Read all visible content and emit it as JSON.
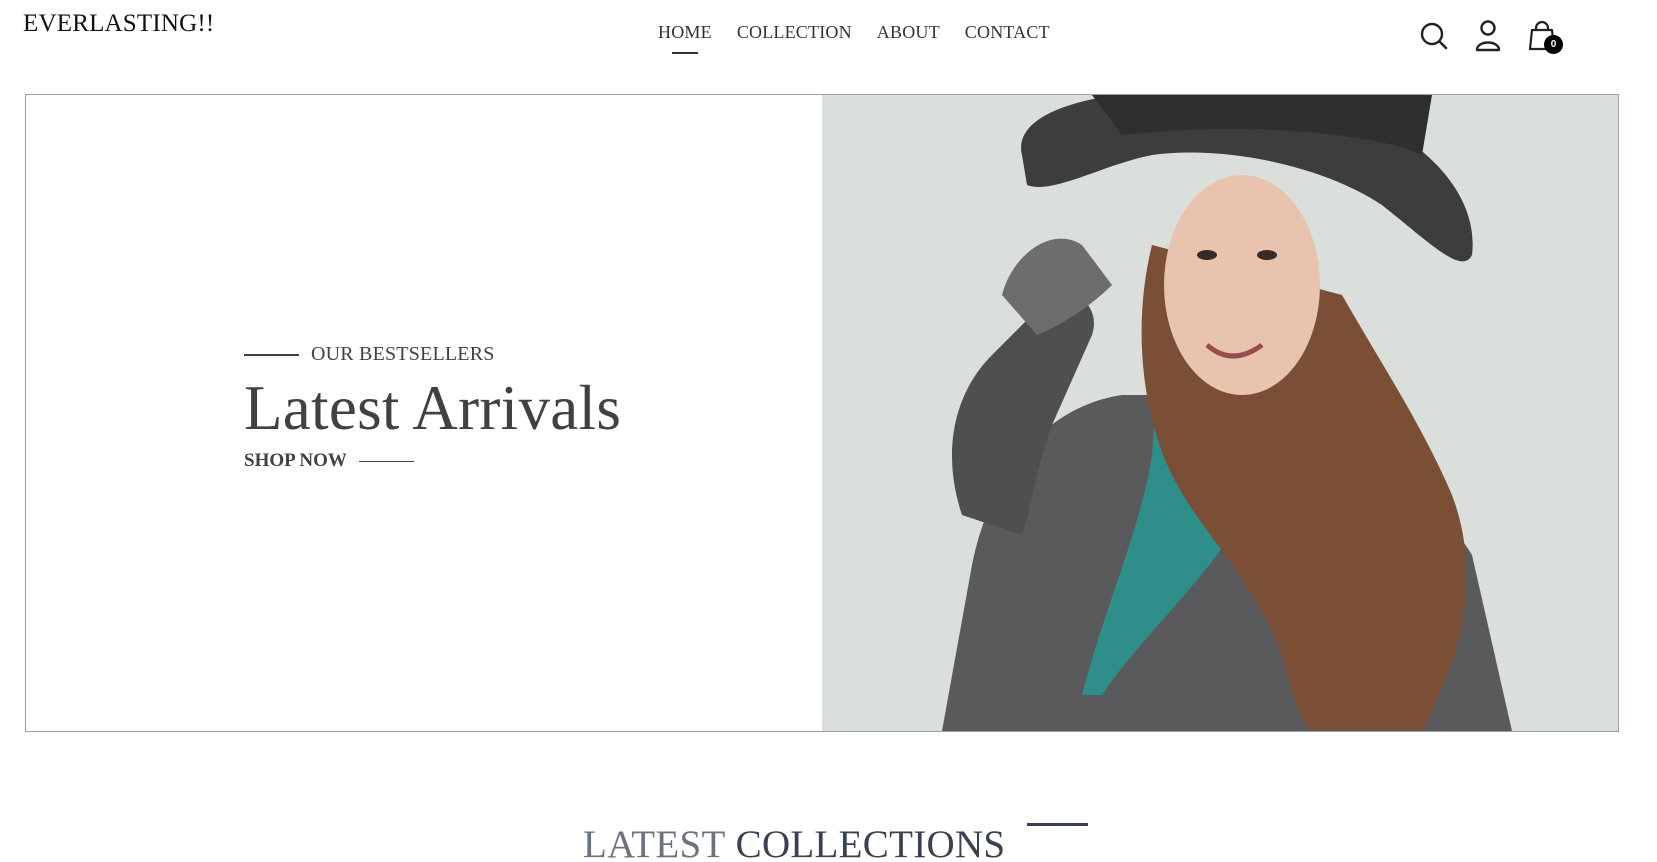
{
  "header": {
    "logo": "EVERLASTING!!",
    "nav": [
      {
        "label": "HOME",
        "active": true
      },
      {
        "label": "COLLECTION",
        "active": false
      },
      {
        "label": "ABOUT",
        "active": false
      },
      {
        "label": "CONTACT",
        "active": false
      }
    ],
    "icons": [
      "search-icon",
      "profile-icon",
      "cart-icon"
    ],
    "cart_count": "0"
  },
  "hero": {
    "eyebrow": "OUR BESTSELLERS",
    "title": "Latest Arrivals",
    "cta": "SHOP NOW",
    "image_background": "#dadfdb"
  },
  "section": {
    "title_part1": "LATEST",
    "title_part2": "COLLECTIONS"
  },
  "colors": {
    "text_dark": "#414141",
    "border": "#9aa0a6",
    "coat": "#5a5a5c",
    "scarf": "#2d8e8a",
    "hair": "#7a4f35"
  }
}
